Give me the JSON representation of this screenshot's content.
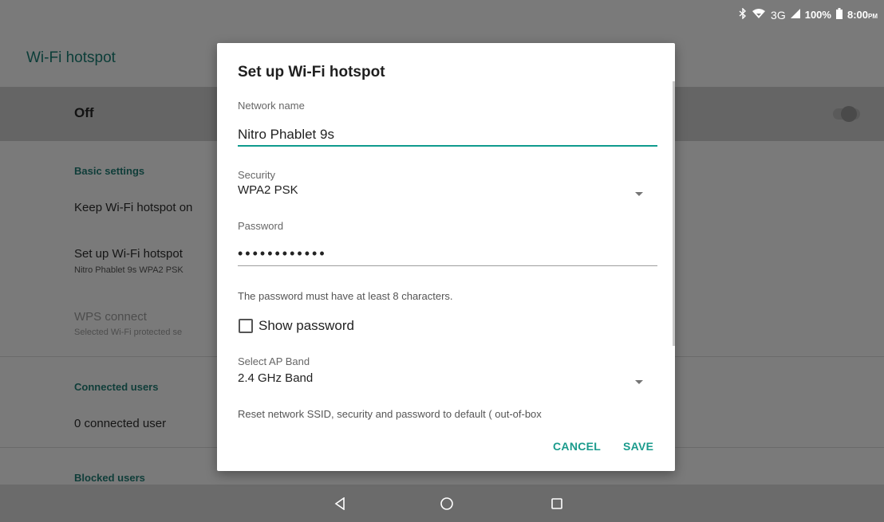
{
  "status_bar": {
    "network": "3G",
    "battery": "100%",
    "time": "8:00",
    "ampm": "PM"
  },
  "app_bar": {
    "title": "Wi-Fi hotspot"
  },
  "main_toggle": {
    "label": "Off",
    "state": "off"
  },
  "sections": {
    "basic": {
      "header": "Basic settings",
      "keep_on": "Keep Wi-Fi hotspot on",
      "setup_title": "Set up Wi-Fi hotspot",
      "setup_sub": "Nitro Phablet 9s WPA2 PSK",
      "wps_title": "WPS connect",
      "wps_sub": "Selected Wi-Fi protected se"
    },
    "connected": {
      "header": "Connected users",
      "count": "0 connected user"
    },
    "blocked": {
      "header": "Blocked users"
    }
  },
  "dialog": {
    "title": "Set up Wi-Fi hotspot",
    "network_name_label": "Network name",
    "network_name_value": "Nitro Phablet 9s",
    "security_label": "Security",
    "security_value": "WPA2 PSK",
    "password_label": "Password",
    "password_mask": "••••••••••••",
    "password_helper": "The password must have at least 8 characters.",
    "show_password_label": "Show password",
    "show_password_checked": false,
    "ap_band_label": "Select AP Band",
    "ap_band_value": "2.4 GHz Band",
    "reset_text": "Reset network SSID, security and password to default ( out-of-box",
    "cancel_label": "CANCEL",
    "save_label": "SAVE"
  },
  "colors": {
    "accent": "#1a9b8c",
    "scrim_bg": "#7a7a7a"
  },
  "icons": {
    "status": [
      "bluetooth-icon",
      "wifi-icon",
      "signal-icon",
      "battery-icon"
    ],
    "nav": [
      "back-icon",
      "home-icon",
      "recents-icon"
    ]
  }
}
